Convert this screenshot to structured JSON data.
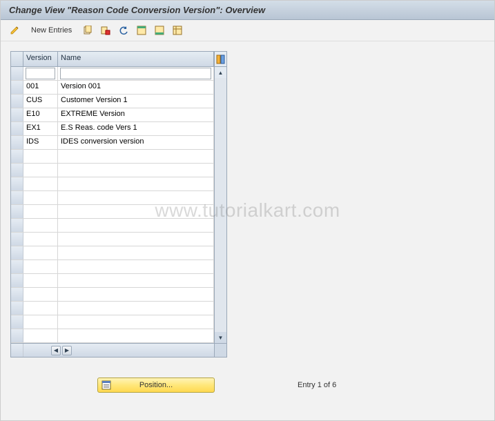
{
  "title": "Change View \"Reason Code Conversion Version\": Overview",
  "toolbar": {
    "new_entries_label": "New Entries"
  },
  "table": {
    "headers": {
      "version": "Version",
      "name": "Name"
    },
    "input_row": {
      "version": "",
      "name": ""
    },
    "rows": [
      {
        "version": "001",
        "name": "Version 001"
      },
      {
        "version": "CUS",
        "name": "Customer Version 1"
      },
      {
        "version": "E10",
        "name": "EXTREME Version"
      },
      {
        "version": "EX1",
        "name": "E.S Reas. code Vers 1"
      },
      {
        "version": "IDS",
        "name": "IDES conversion version"
      }
    ],
    "empty_row": {
      "version": "",
      "name": ""
    }
  },
  "footer": {
    "position_label": "Position...",
    "entry_text": "Entry 1 of 6"
  },
  "watermark": "www.tutorialkart.com"
}
